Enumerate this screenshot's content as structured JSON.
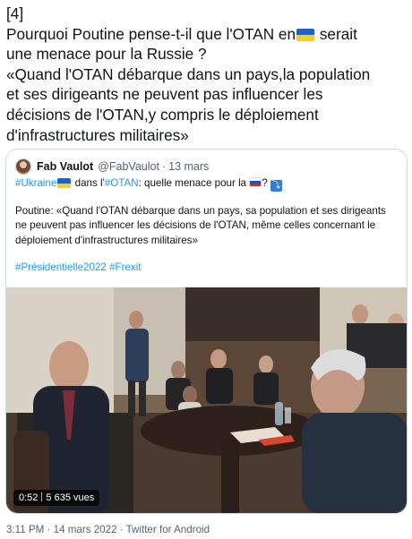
{
  "tweet": {
    "lines": [
      "[4]",
      "Pourquoi Poutine pense-t-il que l'OTAN en",
      "serait",
      "une menace pour la Russie ?",
      "«Quand l'OTAN débarque dans un pays,la population",
      "et ses dirigeants ne peuvent pas influencer les",
      "décisions de l'OTAN,y compris le déploiement",
      "d'infrastructures militaires»"
    ],
    "footer": "3:11 PM · 14 mars 2022 · Twitter for Android"
  },
  "quoted": {
    "name": "Fab Vaulot",
    "handle": "@FabVaulot",
    "separator": "·",
    "date": "13 mars",
    "line1_tag1": "#Ukraine",
    "line1_mid": " dans l'",
    "line1_tag2": "#OTAN",
    "line1_rest": ": quelle menace pour la ",
    "line1_end": "?",
    "body_lines": [
      "Poutine: «Quand l'OTAN débarque dans un pays, sa population et ses dirigeants",
      "ne peuvent pas influencer les décisions de l'OTAN, même celles concernant le",
      "déploiement d'infrastructures militaires»"
    ],
    "tags": [
      "#Présidentielle2022",
      "#Frexit"
    ],
    "video": {
      "duration": "0:52",
      "views": "5 635 vues"
    }
  },
  "colors": {
    "link": "#1d9bf0",
    "secondary": "#536471",
    "border": "#cfd9de"
  },
  "icons": [
    "ukraine-flag-icon",
    "russia-flag-icon",
    "arrow-down-icon"
  ]
}
